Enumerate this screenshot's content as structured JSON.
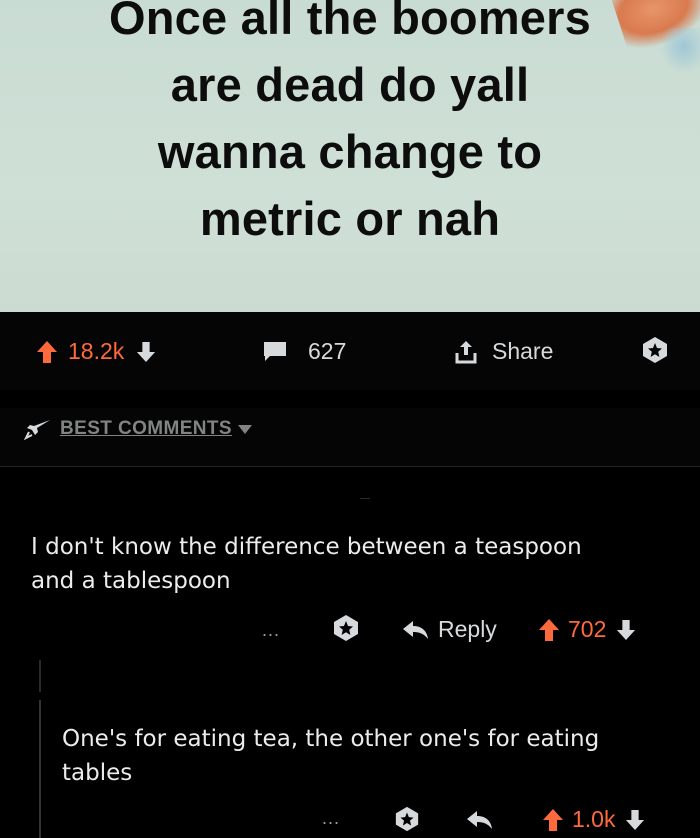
{
  "post": {
    "title_lines": [
      "Once all the boomers",
      "are dead do yall",
      "wanna change to",
      "metric or nah"
    ]
  },
  "action_bar": {
    "upvotes": "18.2k",
    "comments": "627",
    "share_label": "Share"
  },
  "sort": {
    "label": "BEST COMMENTS"
  },
  "comments": [
    {
      "text": "I don't know the difference between a teaspoon and a tablespoon",
      "reply_label": "Reply",
      "score": "702",
      "more": "..."
    },
    {
      "text": "One's for eating tea, the other one's for eating tables",
      "score": "1.0k",
      "more": "..."
    }
  ],
  "colors": {
    "upvote_accent": "#ff6a3d",
    "background": "#000000",
    "image_bg": "#cbdcd2",
    "text": "#d7dadc",
    "muted": "#818384"
  },
  "icons": {
    "upvote": "arrow-up-icon",
    "downvote": "arrow-down-icon",
    "comments": "speech-bubble-icon",
    "share": "share-upload-icon",
    "award": "award-star-icon",
    "sort": "rocket-icon",
    "reply": "reply-arrow-icon"
  }
}
